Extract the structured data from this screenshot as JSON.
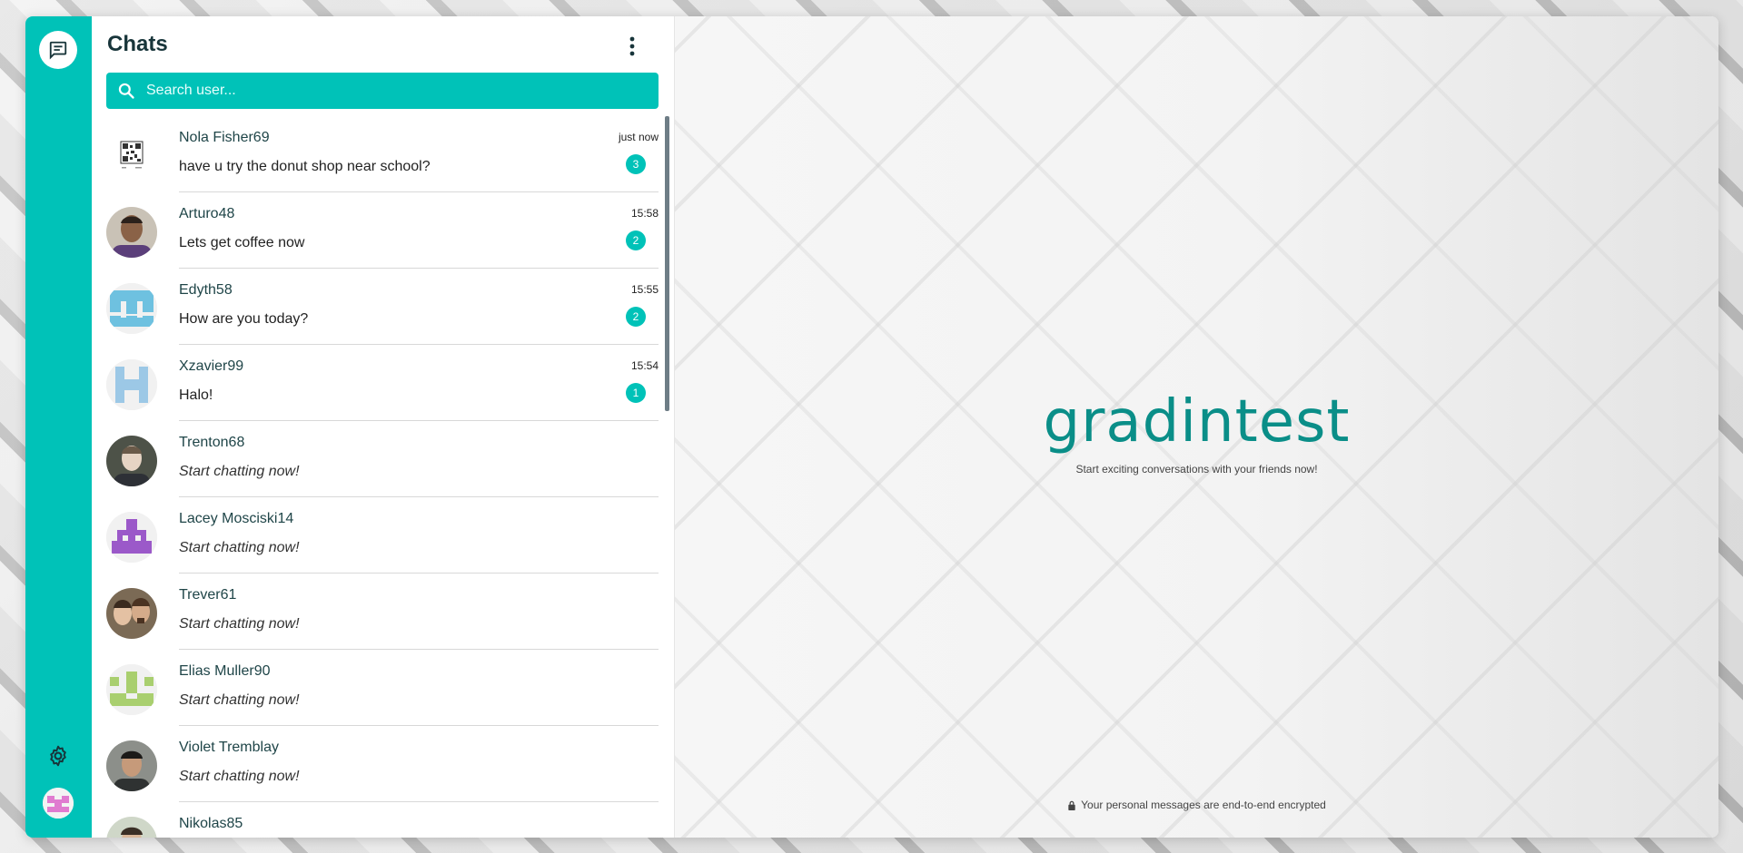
{
  "rail": {
    "chat_icon": "chat-bubble-icon",
    "settings_icon": "gear-icon"
  },
  "sidebar": {
    "title": "Chats",
    "search_placeholder": "Search user...",
    "more_icon": "more-vertical-icon"
  },
  "chats": [
    {
      "name": "Nola Fisher69",
      "message": "have u try the donut shop near school?",
      "time": "just now",
      "unread": "3",
      "avatar": "qr-code"
    },
    {
      "name": "Arturo48",
      "message": "Lets get coffee now",
      "time": "15:58",
      "unread": "2",
      "avatar": "photo"
    },
    {
      "name": "Edyth58",
      "message": "How are you today?",
      "time": "15:55",
      "unread": "2",
      "avatar": "identicon-blue"
    },
    {
      "name": "Xzavier99",
      "message": "Halo!",
      "time": "15:54",
      "unread": "1",
      "avatar": "identicon-lightblue"
    },
    {
      "name": "Trenton68",
      "message": "Start chatting now!",
      "avatar": "photo"
    },
    {
      "name": "Lacey Mosciski14",
      "message": "Start chatting now!",
      "avatar": "identicon-purple"
    },
    {
      "name": "Trever61",
      "message": "Start chatting now!",
      "avatar": "photo"
    },
    {
      "name": "Elias Muller90",
      "message": "Start chatting now!",
      "avatar": "identicon-green"
    },
    {
      "name": "Violet Tremblay",
      "message": "Start chatting now!",
      "avatar": "photo"
    },
    {
      "name": "Nikolas85",
      "message": "",
      "avatar": "photo"
    }
  ],
  "welcome": {
    "brand": "gradintest",
    "tagline": "Start exciting conversations with your friends now!",
    "encryption_note": "Your personal messages are end-to-end encrypted"
  },
  "colors": {
    "accent": "#00c2b8",
    "brand": "#0a8e88"
  }
}
